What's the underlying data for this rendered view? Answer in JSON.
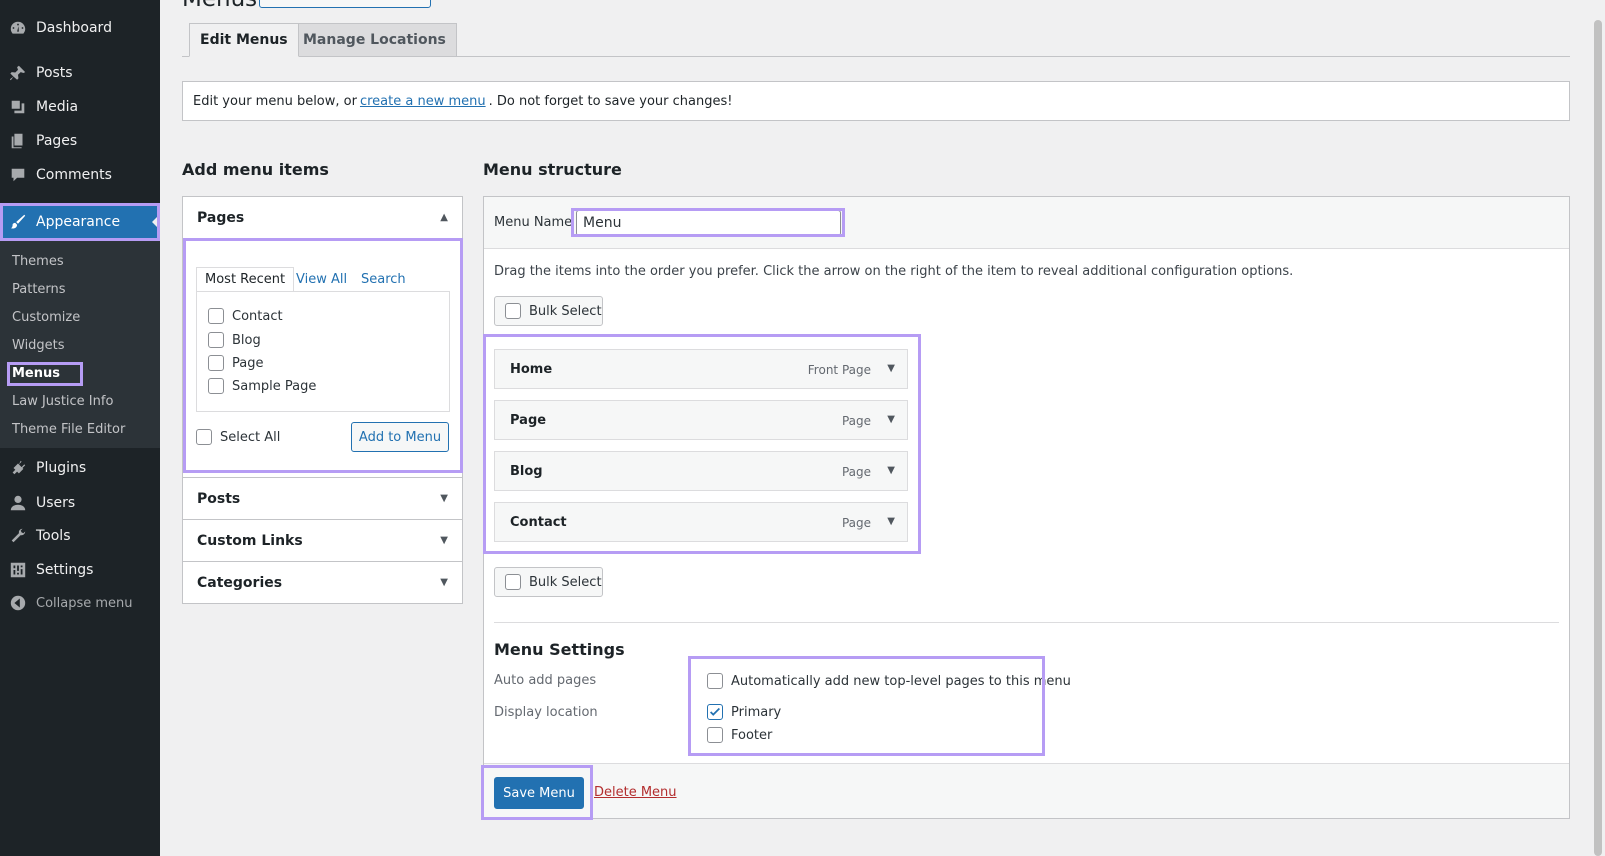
{
  "sidebar": {
    "items": [
      {
        "label": "Dashboard",
        "icon": "dashboard-icon"
      },
      {
        "label": "Posts",
        "icon": "pin-icon"
      },
      {
        "label": "Media",
        "icon": "media-icon"
      },
      {
        "label": "Pages",
        "icon": "pages-icon"
      },
      {
        "label": "Comments",
        "icon": "comment-icon"
      },
      {
        "label": "Appearance",
        "icon": "brush-icon"
      },
      {
        "label": "Plugins",
        "icon": "plug-icon"
      },
      {
        "label": "Users",
        "icon": "user-icon"
      },
      {
        "label": "Tools",
        "icon": "wrench-icon"
      },
      {
        "label": "Settings",
        "icon": "settings-icon"
      }
    ],
    "submenu": [
      "Themes",
      "Patterns",
      "Customize",
      "Widgets",
      "Menus",
      "Law Justice Info",
      "Theme File Editor"
    ],
    "collapse_label": "Collapse menu"
  },
  "header": {
    "title": "Menus"
  },
  "tabs": {
    "edit": "Edit Menus",
    "manage": "Manage Locations"
  },
  "notice": {
    "before": "Edit your menu below, or",
    "link": "create a new menu",
    "after": ". Do not forget to save your changes!"
  },
  "add_items": {
    "title": "Add menu items",
    "pages": {
      "title": "Pages",
      "tabs": [
        "Most Recent",
        "View All",
        "Search"
      ],
      "items": [
        "Contact",
        "Blog",
        "Page",
        "Sample Page"
      ],
      "select_all": "Select All",
      "add_button": "Add to Menu"
    },
    "sections": [
      "Posts",
      "Custom Links",
      "Categories"
    ]
  },
  "structure": {
    "title": "Menu structure",
    "menu_name_label": "Menu Name",
    "menu_name_value": "Menu",
    "instructions": "Drag the items into the order you prefer. Click the arrow on the right of the item to reveal additional configuration options.",
    "bulk_select": "Bulk Select",
    "items": [
      {
        "title": "Home",
        "type": "Front Page"
      },
      {
        "title": "Page",
        "type": "Page"
      },
      {
        "title": "Blog",
        "type": "Page"
      },
      {
        "title": "Contact",
        "type": "Page"
      }
    ],
    "settings": {
      "title": "Menu Settings",
      "auto_add_label": "Auto add pages",
      "auto_add_option": "Automatically add new top-level pages to this menu",
      "display_label": "Display location",
      "locations": [
        {
          "label": "Primary",
          "checked": true
        },
        {
          "label": "Footer",
          "checked": false
        }
      ]
    },
    "save_button": "Save Menu",
    "delete_link": "Delete Menu"
  },
  "colors": {
    "accent": "#2271b1",
    "highlight": "#b69cf4",
    "sidebar": "#1d2327"
  }
}
